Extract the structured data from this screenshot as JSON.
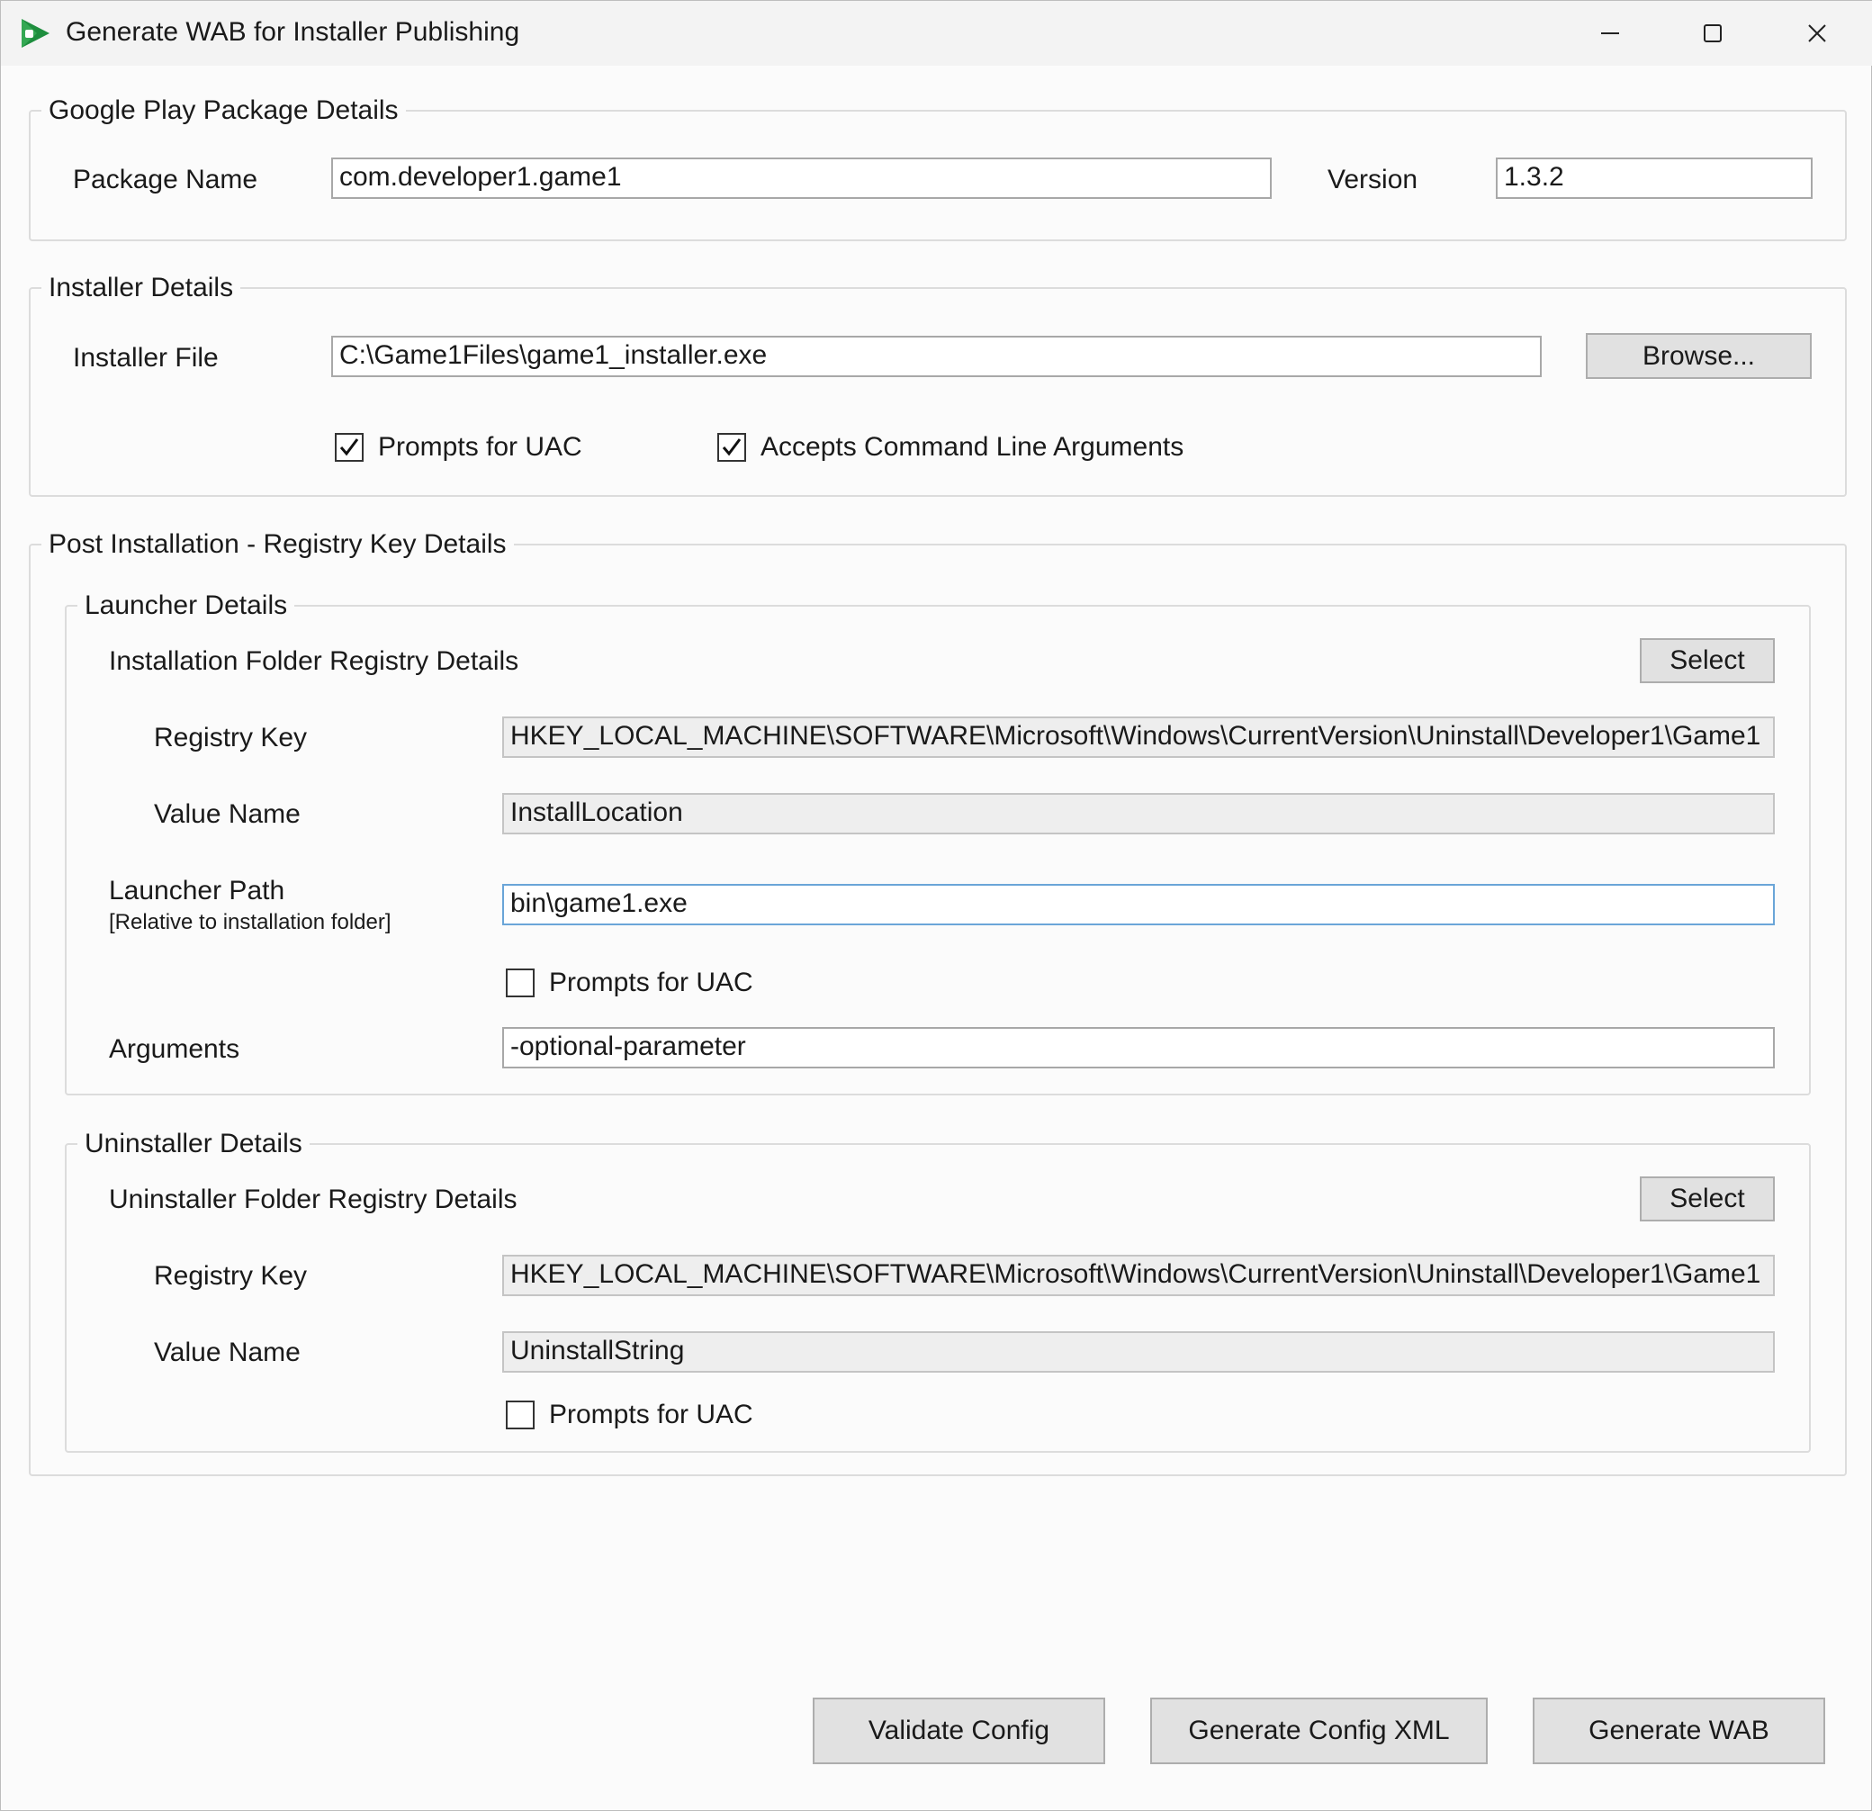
{
  "window": {
    "title": "Generate WAB for Installer Publishing"
  },
  "package_details": {
    "title": "Google Play Package Details",
    "package_name_label": "Package Name",
    "package_name_value": "com.developer1.game1",
    "version_label": "Version",
    "version_value": "1.3.2"
  },
  "installer_details": {
    "title": "Installer Details",
    "installer_file_label": "Installer File",
    "installer_file_value": "C:\\Game1Files\\game1_installer.exe",
    "browse_label": "Browse...",
    "prompts_uac_label": "Prompts for UAC",
    "prompts_uac_checked": true,
    "accepts_args_label": "Accepts Command Line Arguments",
    "accepts_args_checked": true
  },
  "post_install": {
    "title": "Post Installation - Registry Key Details",
    "launcher": {
      "title": "Launcher Details",
      "folder_registry_label": "Installation Folder Registry Details",
      "select_label": "Select",
      "registry_key_label": "Registry Key",
      "registry_key_value": "HKEY_LOCAL_MACHINE\\SOFTWARE\\Microsoft\\Windows\\CurrentVersion\\Uninstall\\Developer1\\Game1",
      "value_name_label": "Value Name",
      "value_name_value": "InstallLocation",
      "launcher_path_label": "Launcher Path",
      "launcher_path_hint": "[Relative to installation folder]",
      "launcher_path_value": "bin\\game1.exe",
      "prompts_uac_label": "Prompts for UAC",
      "prompts_uac_checked": false,
      "arguments_label": "Arguments",
      "arguments_value": "-optional-parameter"
    },
    "uninstaller": {
      "title": "Uninstaller Details",
      "folder_registry_label": "Uninstaller Folder Registry Details",
      "select_label": "Select",
      "registry_key_label": "Registry Key",
      "registry_key_value": "HKEY_LOCAL_MACHINE\\SOFTWARE\\Microsoft\\Windows\\CurrentVersion\\Uninstall\\Developer1\\Game1",
      "value_name_label": "Value Name",
      "value_name_value": "UninstallString",
      "prompts_uac_label": "Prompts for UAC",
      "prompts_uac_checked": false
    }
  },
  "actions": {
    "validate_label": "Validate Config",
    "generate_xml_label": "Generate Config XML",
    "generate_wab_label": "Generate WAB"
  }
}
